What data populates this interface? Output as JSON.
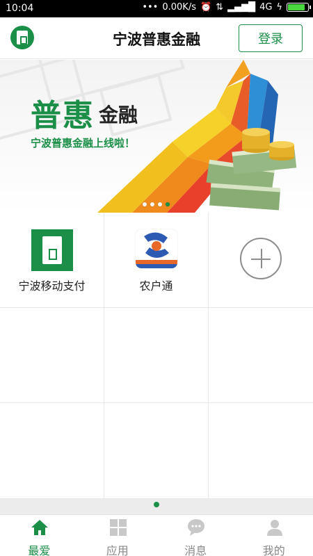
{
  "status_bar": {
    "time": "10:04",
    "network_speed": "0.00K/s",
    "network_type": "4G",
    "battery_icon": "battery-icon",
    "battery_level": 0.9
  },
  "header": {
    "title": "宁波普惠金融",
    "login_label": "登录",
    "logo_icon": "bank-logo-icon"
  },
  "banner": {
    "headline_big": "普惠",
    "headline_small": "金融",
    "tagline": "宁波普惠金融上线啦！",
    "slide_count": 4,
    "active_slide": 4
  },
  "apps": [
    {
      "label": "宁波移动支付",
      "icon": "mobile-pay-icon"
    },
    {
      "label": "农户通",
      "icon": "farmer-link-icon"
    },
    {
      "label": "",
      "icon": "add-icon"
    }
  ],
  "tabs": [
    {
      "label": "最爱",
      "icon": "home-icon",
      "active": true
    },
    {
      "label": "应用",
      "icon": "apps-grid-icon",
      "active": false
    },
    {
      "label": "消息",
      "icon": "message-icon",
      "active": false
    },
    {
      "label": "我的",
      "icon": "profile-icon",
      "active": false
    }
  ],
  "colors": {
    "brand_green": "#1b8e47",
    "inactive_gray": "#888888"
  }
}
